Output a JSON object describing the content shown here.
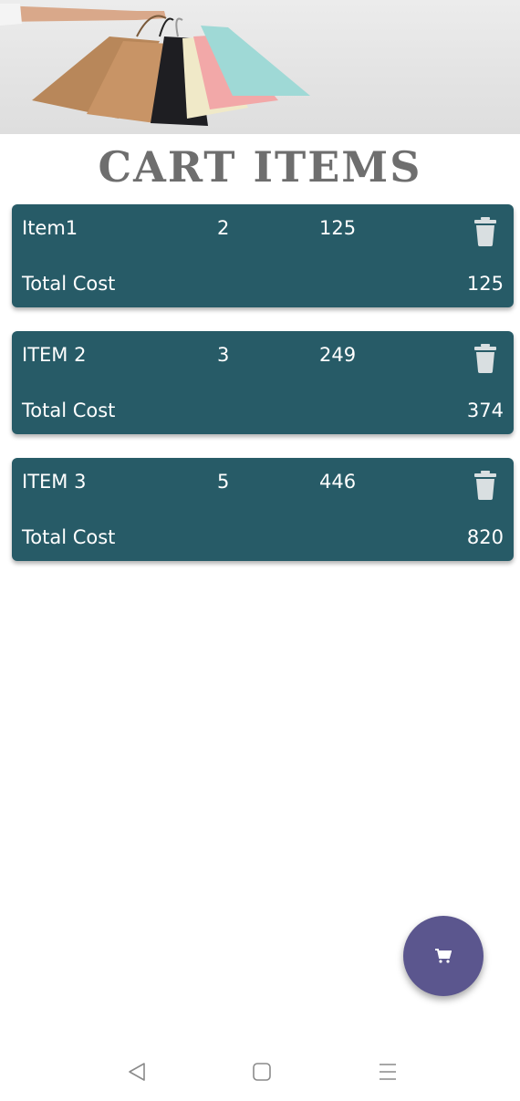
{
  "header": {
    "title": "CART ITEMS"
  },
  "cart": {
    "items": [
      {
        "name": "Item1",
        "quantity": "2",
        "price": "125",
        "total_label": "Total Cost",
        "total": "125"
      },
      {
        "name": "ITEM 2",
        "quantity": "3",
        "price": "249",
        "total_label": "Total Cost",
        "total": "374"
      },
      {
        "name": "ITEM 3",
        "quantity": "5",
        "price": "446",
        "total_label": "Total Cost",
        "total": "820"
      }
    ]
  },
  "icons": {
    "delete": "trash-icon",
    "fab": "cart-icon",
    "nav_back": "back-triangle-icon",
    "nav_home": "home-square-icon",
    "nav_menu": "menu-lines-icon"
  },
  "colors": {
    "card_background": "#275b67",
    "title_text": "#6e6e6e",
    "fab_background": "#5b568e",
    "trash_icon": "#d9dfe1"
  }
}
